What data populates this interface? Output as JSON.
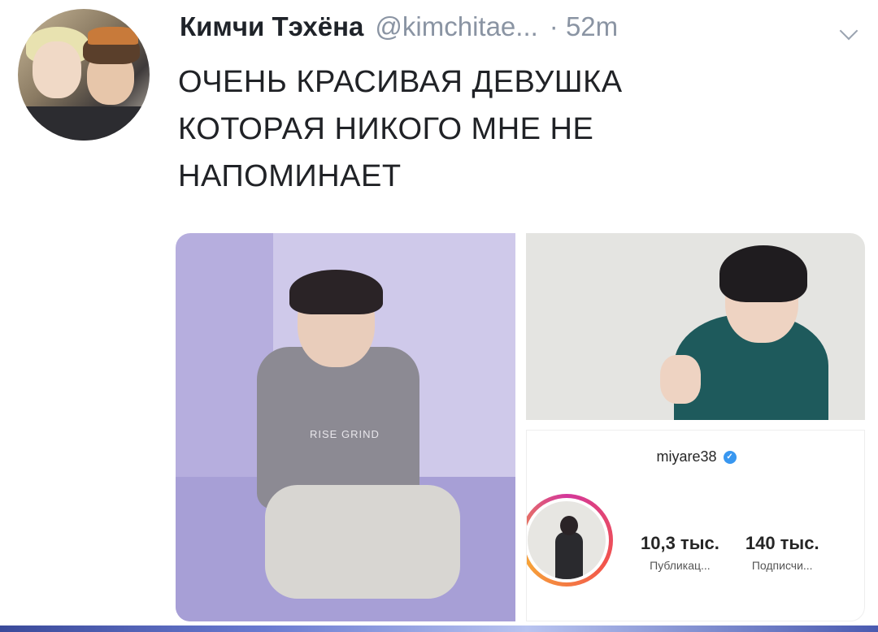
{
  "tweet": {
    "author": {
      "display_name": "Кимчи Тэхёна",
      "handle": "@kimchitae...",
      "time": "· 52m"
    },
    "text": "ОЧЕНЬ КРАСИВАЯ ДЕВУШКА КОТОРАЯ НИКОГО МНЕ НЕ НАПОМИНАЕТ",
    "media": {
      "left_photo_text": "RISE GRIND",
      "instagram_card": {
        "username": "miyare38",
        "verified_mark": "✓",
        "stats": [
          {
            "value": "10,3 тыс.",
            "label": "Публикац..."
          },
          {
            "value": "140 тыс.",
            "label": "Подписчи..."
          }
        ]
      }
    }
  },
  "icons": [
    "chevron-down-icon",
    "verified-icon"
  ],
  "colors": {
    "text": "#202226",
    "muted": "#8a94a3",
    "verified": "#3897f0"
  }
}
